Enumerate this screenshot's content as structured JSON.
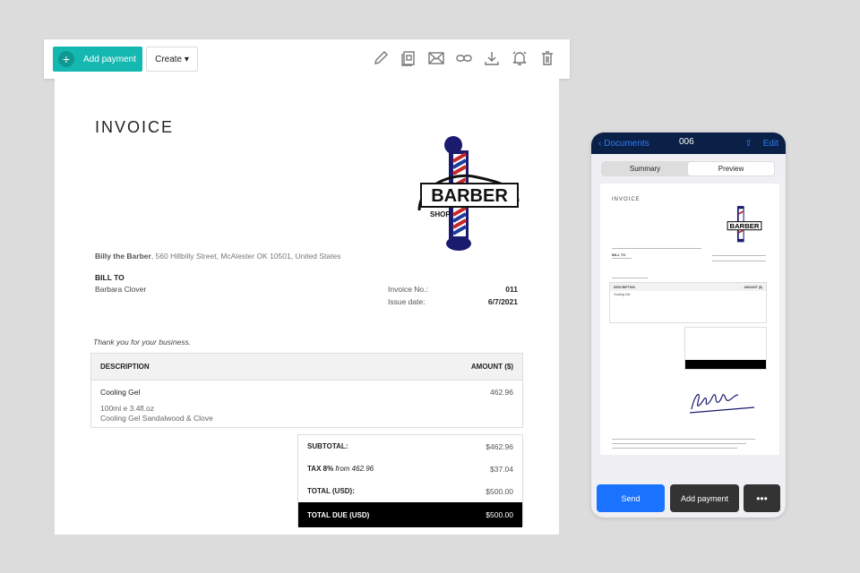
{
  "toolbar": {
    "add_payment": "Add payment",
    "create": "Create ▾",
    "icons": [
      "pencil-icon",
      "copy-icon",
      "mail-icon",
      "link-icon",
      "download-icon",
      "bell-icon",
      "trash-icon"
    ]
  },
  "invoice": {
    "title": "INVOICE",
    "logo_text": "BARBER SHOP",
    "seller_name": "Billy the Barber",
    "seller_address": ", 560 Hillbilly Street, McAlester OK 10501, United States",
    "bill_to_label": "BILL TO",
    "client": "Barbara Clover",
    "invoice_no_label": "Invoice No.:",
    "invoice_no": "011",
    "issue_date_label": "Issue date:",
    "issue_date": "6/7/2021",
    "thanks": "Thank you for your business.",
    "table": {
      "headers": [
        "DESCRIPTION",
        "AMOUNT ($)"
      ],
      "rows": [
        {
          "name": "Cooling Gel",
          "amount": "462.96",
          "detail1": "100ml e 3.4fl.oz",
          "detail2": "Cooling Gel Sandalwood & Clove"
        }
      ]
    },
    "totals": {
      "subtotal_label": "SUBTOTAL:",
      "subtotal": "$462.96",
      "tax_label": "TAX 8%",
      "tax_from": " from 462.96",
      "tax": "$37.04",
      "total_label": "TOTAL (USD):",
      "total": "$500.00",
      "due_label": "TOTAL DUE (USD)",
      "due": "$500.00"
    }
  },
  "phone": {
    "back": "Documents",
    "title": "006",
    "edit": "Edit",
    "tabs": [
      "Summary",
      "Preview"
    ],
    "mini": {
      "title": "INVOICE",
      "logo_text": "BARBER",
      "bill_to": "BILL TO",
      "description": "DESCRIPTION",
      "amount": "AMOUNT ($)",
      "cooling_gel": "Cooling Gel"
    },
    "send": "Send",
    "add_payment": "Add payment",
    "more": "•••",
    "colors": {
      "header": "#0b2046",
      "send": "#1a73ff",
      "dark": "#333333"
    }
  }
}
